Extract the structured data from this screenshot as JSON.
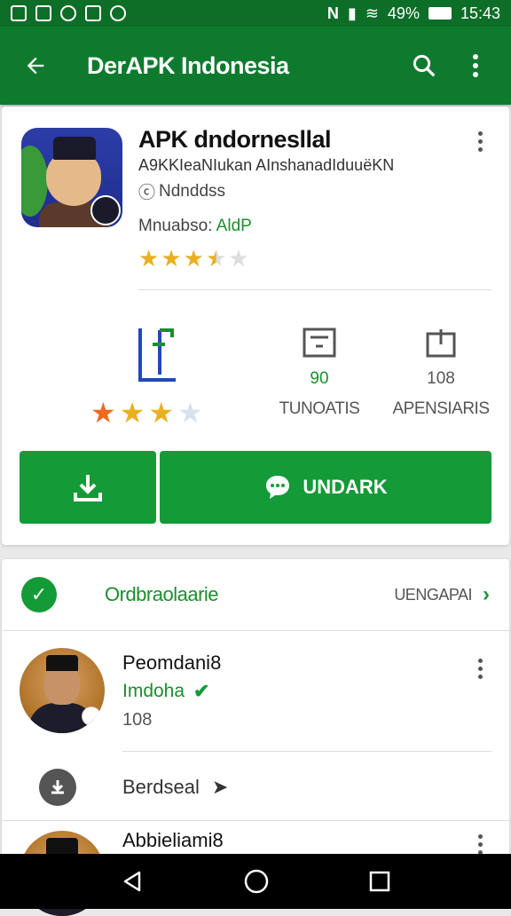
{
  "status_bar": {
    "signal_text": "N",
    "battery": "49%",
    "time": "15:43"
  },
  "app_bar": {
    "title": "DerAPK Indonesia"
  },
  "app_card": {
    "name": "APK dndornesllal",
    "subtitle": "A9KKIeaNIukan AInshanadIduuëKN",
    "developer": "Ndnddss",
    "meta_label": "Mnuabso: ",
    "meta_value": "AldP",
    "rating_top": 3.5,
    "rating_big": 3,
    "stats": [
      {
        "value": "90",
        "label": "TUNOATIS"
      },
      {
        "value": "108",
        "label": "APENSIARIS"
      }
    ],
    "primary_button": "UNDARK"
  },
  "list_card": {
    "header_left": "Ordbraolaarie",
    "header_right": "UENGAPAI",
    "person1": {
      "name": "Peomdani8",
      "subtitle": "Imdoha",
      "count": "108"
    },
    "download_row_label": "Berdseal",
    "person2": {
      "name": "Abbieliami8"
    }
  },
  "colors": {
    "app_bar": "#0e7a2e",
    "accent": "#149a37",
    "star": "#e9b020"
  }
}
